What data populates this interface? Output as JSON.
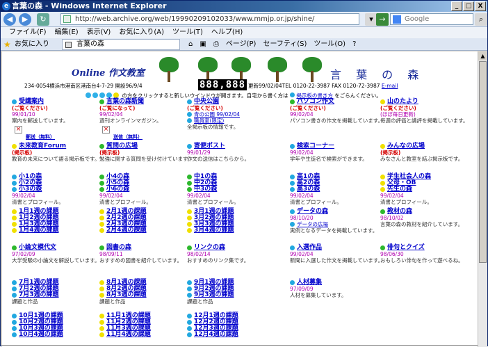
{
  "window": {
    "title": "言葉の森 - Windows Internet Explorer",
    "buttons": [
      "_",
      "□",
      "X"
    ]
  },
  "address_bar": {
    "url": "http://web.archive.org/web/19990209102033/www.mmjp.or.jp/shine/",
    "search_placeholder": "Google"
  },
  "menu": [
    "ファイル(F)",
    "編集(E)",
    "表示(V)",
    "お気に入り(A)",
    "ツール(T)",
    "ヘルプ(H)"
  ],
  "favorites_bar": {
    "label": "お気に入り",
    "tab_title": "言葉の森"
  },
  "toolbar_right": [
    "ページ(P)",
    "セーフティ(S)",
    "ツール(O)"
  ],
  "header": {
    "online": "Online 作文教室",
    "site_title": "言 葉 の 森",
    "address_line": "234-0054横浜市港南区港南台4-7-29 開設96/9/4",
    "counter": "888,888",
    "address_line2": "更新99/02/04TEL 0120-22-3987 FAX 0120-72-3987",
    "email": "E-mail",
    "note": "の方をクリックすると新しいウインドウが開きます。自宅から書く方は",
    "note_link": "掲示板の書き方",
    "note_end": "をごらんください。"
  },
  "cells": [
    {
      "bullet": "blue",
      "links": [
        "受講案内"
      ],
      "sub": "(ご覧ください)",
      "date": "99/01/10",
      "desc": "案内を郵送しています。",
      "mail": "郵送（無料）"
    },
    {
      "bullet": "green",
      "links": [
        "言葉の森新聞"
      ],
      "sub": "(ご覧になって)",
      "date": "99/02/04",
      "desc": "週刊オンラインマガジン。",
      "mail": "送信（無料）"
    },
    {
      "bullet": "blue",
      "links": [
        "中央公園"
      ],
      "sub": "(ご覧ください)",
      "date": "",
      "desc": "全掲示板の情報です。",
      "extra": [
        "青の公園 99/02/04",
        "職員室(限定)"
      ]
    },
    {
      "bullet": "green",
      "links": [
        "パソコン作文"
      ],
      "sub": "(ご覧ください)",
      "date": "99/02/04",
      "desc": "パソコン書きの作文を掲載しています。"
    },
    {
      "bullet": "yellow",
      "links": [
        "山のたより"
      ],
      "sub": "(ご覧ください)",
      "date": "(ほぼ毎日更新)",
      "desc": "毎週の評価と講評を掲載しています。"
    },
    {
      "bullet": "yellow",
      "links": [
        "未来教育Forum"
      ],
      "sub": "(掲示板)",
      "date": "",
      "desc": "教育の未来について語る掲示板です。"
    },
    {
      "bullet": "green",
      "links": [
        "質問の広場"
      ],
      "sub": "(掲示板)",
      "date": "",
      "desc": "勉強に関する質問を受け付けています。"
    },
    {
      "bullet": "blue",
      "links": [
        "寄便ポスト"
      ],
      "sub": "",
      "date": "99/01/29",
      "desc": "作文の送信はこちらから。"
    },
    {
      "bullet": "blue",
      "links": [
        "検索コーナー"
      ],
      "sub": "",
      "date": "99/02/04",
      "desc": "学年や生徒名で検索ができます。"
    },
    {
      "bullet": "yellow",
      "links": [
        "みんなの広場"
      ],
      "sub": "(掲示板)",
      "date": "",
      "desc": "みなさんと教室を結ぶ掲示板です。"
    },
    {
      "bullet": "blue",
      "links": [
        "小1の森",
        "小2の森",
        "小3の森"
      ],
      "date": "99/02/04",
      "desc": "清書とプロフィール。"
    },
    {
      "bullet": "green",
      "links": [
        "小4の森",
        "小5の森",
        "小6の森"
      ],
      "date": "99/02/04",
      "desc": "清書とプロフィール。"
    },
    {
      "bullet": "green",
      "links": [
        "中1の森",
        "中2の森",
        "中3の森"
      ],
      "date": "99/02/04",
      "desc": "清書とプロフィール。"
    },
    {
      "bullet": "blue",
      "links": [
        "高1の森",
        "高2の森",
        "高3の森"
      ],
      "date": "99/02/04",
      "desc": "清書とプロフィール。"
    },
    {
      "bullet": "yellow",
      "links": [
        "学生社会人の森",
        "父母・OB",
        "先生の森"
      ],
      "date": "99/02/04",
      "desc": "清書とプロフィール。"
    },
    {
      "bullet": "yellow",
      "links": [
        "1月1週の課題",
        "1月2週の課題",
        "1月3週の課題",
        "1月4週の課題"
      ]
    },
    {
      "bullet": "yellow",
      "links": [
        "2月1週の課題",
        "2月2週の課題",
        "2月3週の課題",
        "2月4週の課題"
      ]
    },
    {
      "bullet": "yellow",
      "links": [
        "3月1週の課題",
        "3月2週の課題",
        "3月3週の課題",
        "3月4週の課題"
      ]
    },
    {
      "bullet": "blue",
      "links": [
        "データの森"
      ],
      "sub": "",
      "date": "98/10/20",
      "desc": "実例となるデータを掲載しています。",
      "extra": [
        "データの広場"
      ]
    },
    {
      "bullet": "green",
      "links": [
        "教材の森"
      ],
      "sub": "",
      "date": "98/10/02",
      "desc": "言葉の森の教材を紹介しています。"
    },
    {
      "bullet": "green",
      "links": [
        "小論文模代文"
      ],
      "sub": "",
      "date": "97/02/09",
      "desc": "大学受験の小論文を解説しています。"
    },
    {
      "bullet": "green",
      "links": [
        "図書の森"
      ],
      "sub": "",
      "date": "98/09/11",
      "desc": "おすすめの図書を紹介しています。"
    },
    {
      "bullet": "green",
      "links": [
        "リンクの森"
      ],
      "sub": "",
      "date": "98/02/14",
      "desc": "おすすめのリンク集です。"
    },
    {
      "bullet": "blue",
      "links": [
        "入選作品"
      ],
      "sub": "",
      "date": "99/02/04",
      "desc": "新聞に入選した作文を掲載しています。"
    },
    {
      "bullet": "green",
      "links": [
        "俳句とクイズ"
      ],
      "sub": "",
      "date": "98/06/30",
      "desc": "おもしろい俳句を作って遊べるね。"
    },
    {
      "bullet": "blue",
      "links": [
        "7月1週の課題",
        "7月2週の課題",
        "7月3週の課題"
      ],
      "desc": "課題と作品"
    },
    {
      "bullet": "yellow",
      "links": [
        "8月1週の課題",
        "8月2週の課題",
        "8月3週の課題"
      ],
      "desc": "課題と作品"
    },
    {
      "bullet": "blue",
      "links": [
        "9月1週の課題",
        "9月2週の課題",
        "9月3週の課題"
      ],
      "desc": "課題と作品"
    },
    {
      "bullet": "blue",
      "links": [
        "人材募集"
      ],
      "sub": "",
      "date": "97/09/09",
      "desc": "人材を募集しています。"
    },
    {
      "bullet": "blue",
      "links": [
        "10月1週の課題",
        "10月2週の課題",
        "10月3週の課題",
        "10月4週の課題"
      ]
    },
    {
      "bullet": "yellow",
      "links": [
        "11月1週の課題",
        "11月2週の課題",
        "11月3週の課題",
        "11月4週の課題"
      ]
    },
    {
      "bullet": "blue",
      "links": [
        "12月1週の課題",
        "12月2週の課題",
        "12月3週の課題",
        "12月4週の課題"
      ]
    }
  ]
}
